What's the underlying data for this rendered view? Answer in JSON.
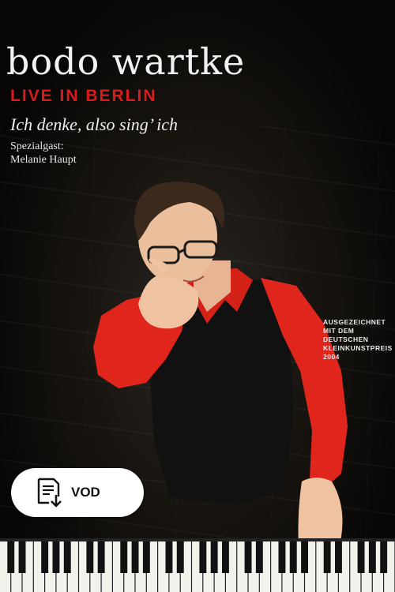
{
  "poster": {
    "title": "bodo wartke",
    "subtitle": "LIVE IN BERLIN",
    "tagline": "Ich denke, also sing’ ich",
    "guest_label": "Spezialgast:",
    "guest_name": "Melanie Haupt",
    "award_lines": [
      "AUSGEZEICHNET",
      "MIT DEM",
      "DEUTSCHEN",
      "KLEINKUNSTPREIS",
      "2004"
    ]
  },
  "badge": {
    "label": "VOD",
    "icon": "document-download-icon"
  },
  "colors": {
    "accent_red": "#d61c1c",
    "shirt_red": "#e0261c",
    "background": "#0b0a09",
    "badge_bg": "#ffffff"
  }
}
